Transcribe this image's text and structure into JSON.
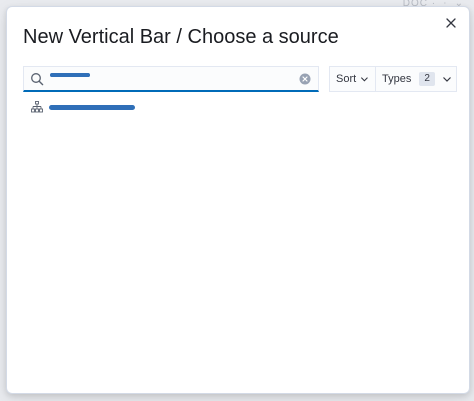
{
  "modal": {
    "title": "New Vertical Bar / Choose a source"
  },
  "search": {
    "value": "",
    "placeholder": ""
  },
  "filters": {
    "sort_label": "Sort",
    "types_label": "Types",
    "types_count": "2"
  },
  "results": {
    "items": [
      {
        "label": "",
        "icon": "index-pattern-icon"
      }
    ]
  },
  "colors": {
    "accent": "#006bb8",
    "text": "#1a1c21",
    "link": "#1f5ea8"
  }
}
